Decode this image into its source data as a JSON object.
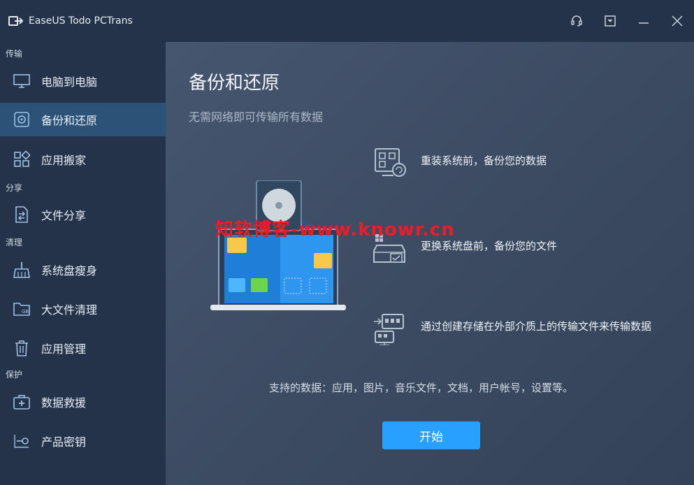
{
  "app": {
    "title": "EaseUS Todo PCTrans"
  },
  "sidebar": {
    "sections": {
      "transfer": "传输",
      "share": "分享",
      "clean": "清理",
      "protect": "保护"
    },
    "items": [
      {
        "label": "电脑到电脑",
        "icon": "monitor-icon"
      },
      {
        "label": "备份和还原",
        "icon": "disc-backup-icon"
      },
      {
        "label": "应用搬家",
        "icon": "app-grid-icon"
      },
      {
        "label": "文件分享",
        "icon": "file-share-icon"
      },
      {
        "label": "系统盘瘦身",
        "icon": "broom-icon"
      },
      {
        "label": "大文件清理",
        "icon": "gb-folder-icon"
      },
      {
        "label": "应用管理",
        "icon": "trash-icon"
      },
      {
        "label": "数据救援",
        "icon": "rescue-kit-icon"
      },
      {
        "label": "产品密钥",
        "icon": "key-icon"
      }
    ]
  },
  "main": {
    "title": "备份和还原",
    "subtitle": "无需网络即可传输所有数据",
    "features": [
      {
        "text": "重装系统前，备份您的数据",
        "icon": "system-backup-icon"
      },
      {
        "text": "更换系统盘前，备份您的文件",
        "icon": "disk-swap-icon"
      },
      {
        "text": "通过创建存储在外部介质上的传输文件来传输数据",
        "icon": "external-transfer-icon"
      }
    ],
    "supported": "支持的数据：应用，图片，音乐文件，文档，用户帐号，设置等。",
    "start_label": "开始"
  },
  "watermark": "知软博客-www.knowr.cn",
  "colors": {
    "accent": "#27a0ff",
    "sidebar_bg": "#24324a",
    "active_item": "#2d5277",
    "watermark": "#ee1c24"
  }
}
